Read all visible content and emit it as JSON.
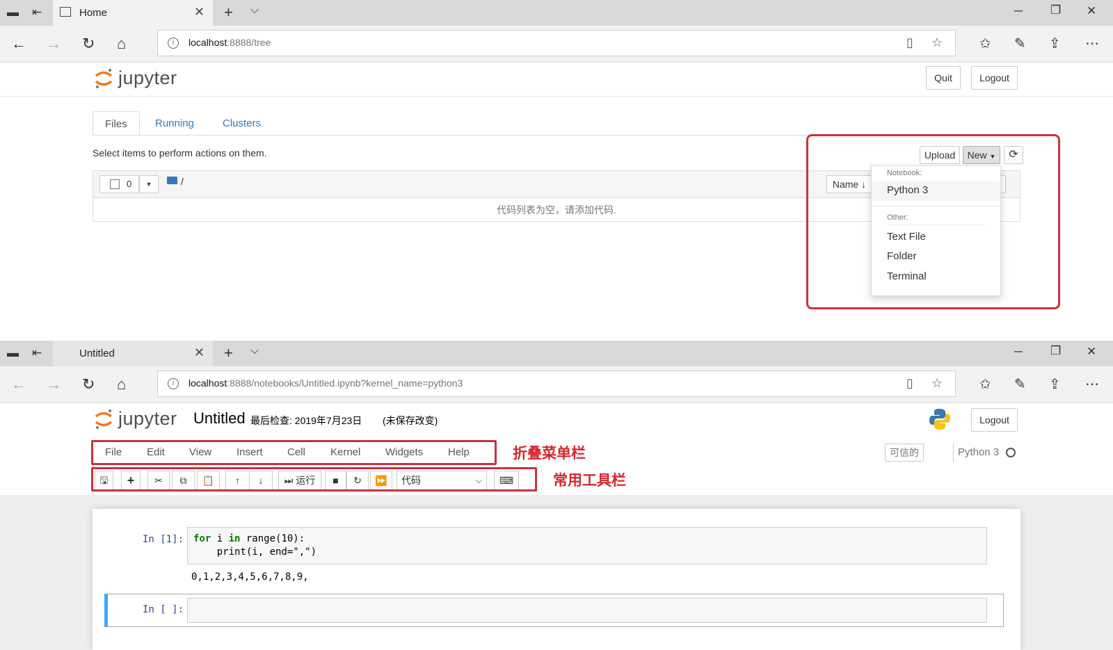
{
  "browser_top": {
    "tab_title": "Home",
    "url_host": "localhost",
    "url_path": ":8888/tree"
  },
  "browser_bottom": {
    "tab_title": "Untitled",
    "url_host": "localhost",
    "url_path": ":8888/notebooks/Untitled.ipynb?kernel_name=python3"
  },
  "jupyter": {
    "logo_text": "jupyter",
    "quit_label": "Quit",
    "logout_label": "Logout"
  },
  "tree": {
    "tabs": [
      {
        "label": "Files"
      },
      {
        "label": "Running"
      },
      {
        "label": "Clusters"
      }
    ],
    "instructions": "Select items to perform actions on them.",
    "selected_count": "0",
    "path": "/",
    "empty_message": "代码列表为空，请添加代码.",
    "upload_label": "Upload",
    "new_label": "New",
    "name_sort_label": "Name",
    "dropdown": {
      "notebook_header": "Notebook:",
      "python3": "Python 3",
      "other_header": "Other:",
      "text_file": "Text File",
      "folder": "Folder",
      "terminal": "Terminal"
    }
  },
  "notebook": {
    "title": "Untitled",
    "checkpoint": "最后检查: 2019年7月23日",
    "unsaved": "(未保存改变)",
    "menu": [
      "File",
      "Edit",
      "View",
      "Insert",
      "Cell",
      "Kernel",
      "Widgets",
      "Help"
    ],
    "trusted_label": "可信的",
    "kernel_label": "Python 3",
    "run_label": "运行",
    "cell_type": "代码",
    "annotation_menu": "折叠菜单栏",
    "annotation_toolbar": "常用工具栏",
    "cells": [
      {
        "prompt": "In [1]:",
        "code_line1_kw1": "for",
        "code_line1_var": " i ",
        "code_line1_kw2": "in",
        "code_line1_rest": " range(10):",
        "code_line2": "    print(i, end=\",\")",
        "output": "0,1,2,3,4,5,6,7,8,9,"
      },
      {
        "prompt": "In [ ]:"
      }
    ]
  }
}
